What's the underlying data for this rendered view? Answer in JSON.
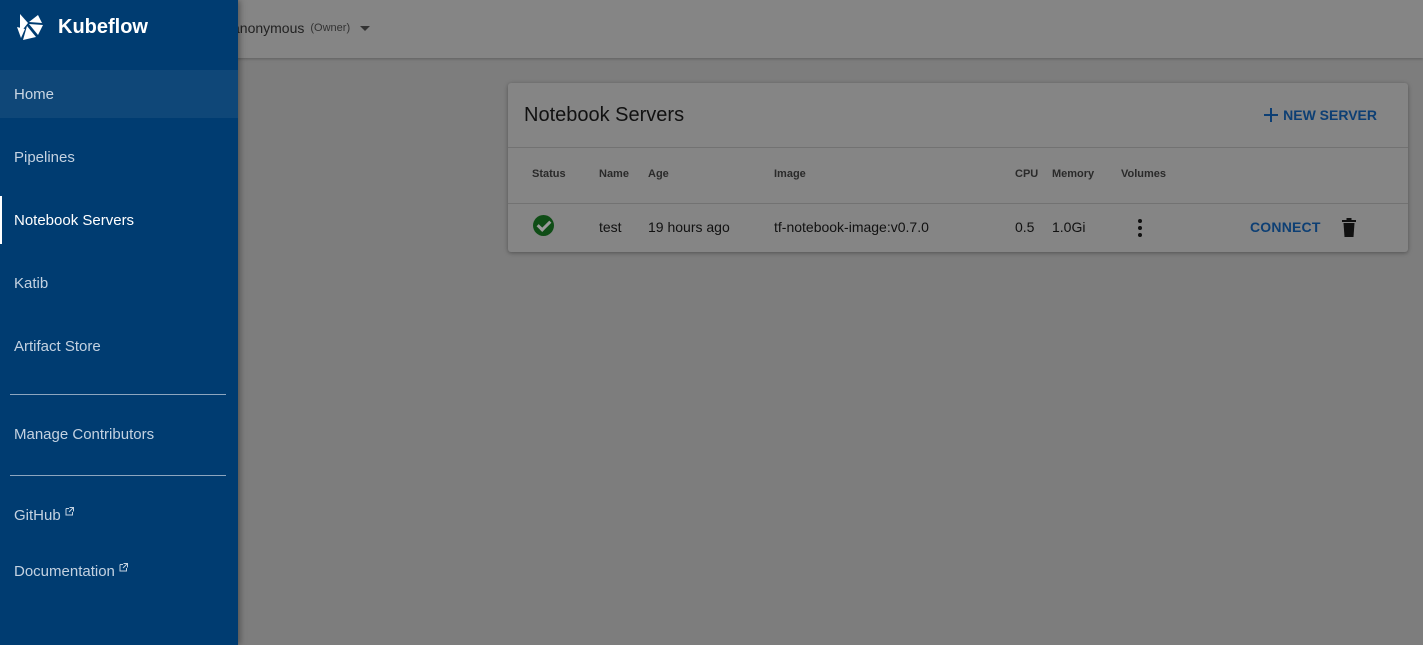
{
  "app": {
    "brand": "Kubeflow"
  },
  "header": {
    "namespace": "anonymous",
    "role": "(Owner)"
  },
  "sidebar": {
    "items": [
      {
        "label": "Home"
      },
      {
        "label": "Pipelines"
      },
      {
        "label": "Notebook Servers"
      },
      {
        "label": "Katib"
      },
      {
        "label": "Artifact Store"
      }
    ],
    "manage": "Manage Contributors",
    "links": [
      {
        "label": "GitHub"
      },
      {
        "label": "Documentation"
      }
    ]
  },
  "notebooks": {
    "title": "Notebook Servers",
    "new_server": "NEW SERVER",
    "columns": {
      "status": "Status",
      "name": "Name",
      "age": "Age",
      "image": "Image",
      "cpu": "CPU",
      "memory": "Memory",
      "volumes": "Volumes"
    },
    "rows": [
      {
        "status": "ready",
        "name": "test",
        "age": "19 hours ago",
        "image": "tf-notebook-image:v0.7.0",
        "cpu": "0.5",
        "memory": "1.0Gi",
        "connect": "CONNECT"
      }
    ]
  },
  "colors": {
    "sidebar": "#003c71",
    "accent": "#0d3f74",
    "status_ok": "#0f4d16"
  }
}
